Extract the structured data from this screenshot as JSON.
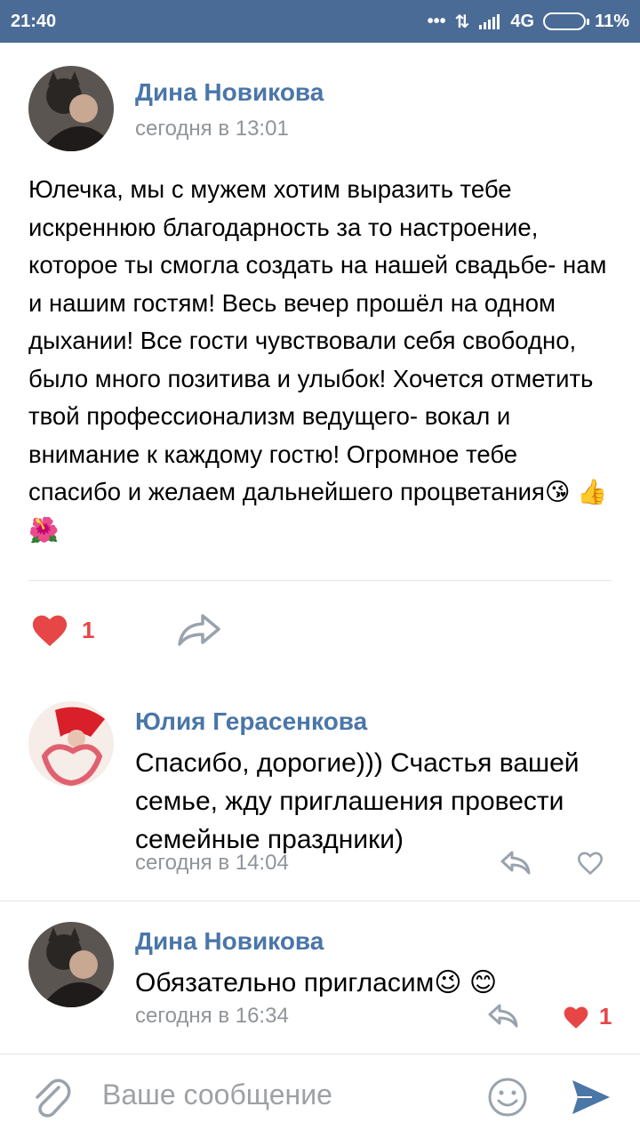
{
  "status_bar": {
    "time": "21:40",
    "signal": "4G",
    "battery": "11%"
  },
  "post": {
    "author": "Дина Новикова",
    "timestamp": "сегодня в 13:01",
    "text": "Юлечка, мы с мужем хотим выразить тебе искреннюю благодарность за то настроение, которое ты смогла создать на нашей свадьбе- нам и нашим гостям! Весь вечер прошёл на одном дыхании! Все гости чувствовали себя свободно, было много позитива и улыбок! Хочется отметить твой профессионализм ведущего- вокал и внимание к каждому гостю! Огромное тебе спасибо и желаем дальнейшего процветания😘 👍 🌺",
    "likes": "1"
  },
  "comments": [
    {
      "author": "Юлия Герасенкова",
      "text": "Спасибо, дорогие))) Счастья вашей семье, жду приглашения провести семейные праздники)",
      "timestamp": "сегодня в 14:04"
    },
    {
      "author": "Дина Новикова",
      "text": "Обязательно пригласим😉 😊",
      "timestamp": "сегодня в 16:34",
      "likes": "1"
    }
  ],
  "composer": {
    "placeholder": "Ваше сообщение"
  },
  "colors": {
    "status_bar": "#4a6b96",
    "link": "#4a76a8",
    "like": "#e64646",
    "muted": "#909499"
  },
  "icons": [
    "signal-icon",
    "battery-icon",
    "heart-icon",
    "share-icon",
    "reply-icon",
    "attach-icon",
    "emoji-icon",
    "send-icon"
  ]
}
